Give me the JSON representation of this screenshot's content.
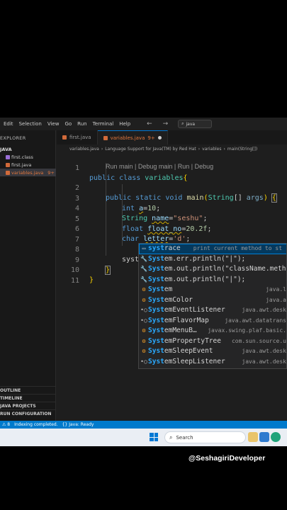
{
  "menubar": {
    "items": [
      "Edit",
      "Selection",
      "View",
      "Go",
      "Run",
      "Terminal",
      "Help"
    ],
    "nav_arrows": "← →",
    "search_text": "java"
  },
  "sidebar": {
    "title": "EXPLORER",
    "folder": "JAVA",
    "files": [
      {
        "name": "first.class",
        "badge": ""
      },
      {
        "name": "first.java",
        "badge": ""
      },
      {
        "name": "variables.java",
        "badge": "9+"
      }
    ],
    "sections": [
      "OUTLINE",
      "TIMELINE",
      "JAVA PROJECTS",
      "RUN CONFIGURATION"
    ]
  },
  "tabs": [
    {
      "label": "first.java",
      "badge": ""
    },
    {
      "label": "variables.java",
      "badge": "9+"
    }
  ],
  "breadcrumb": {
    "file": "variables.java",
    "lang": "Language Support for Java(TM) by Red Hat",
    "class": "variables",
    "method": "main(String[])"
  },
  "editor": {
    "line_numbers": [
      "1",
      "",
      "2",
      "3",
      "4",
      "5",
      "6",
      "7",
      "8",
      "9",
      "10",
      "11"
    ],
    "codelens": "Run main | Debug main | Run | Debug",
    "lines": {
      "l1": {
        "k1": "public",
        "k2": "class",
        "name": "variables",
        "brace": "{"
      },
      "l2": {
        "k1": "public",
        "k2": "static",
        "k3": "void",
        "fn": "main",
        "p1": "(",
        "ty": "String",
        "p2": "[] ",
        "arg": "args",
        "p3": ")",
        "brace": "{"
      },
      "l3": {
        "ty": "int",
        "var": "a",
        "eq": "=",
        "num": "10",
        "end": ";"
      },
      "l4": {
        "ty": "String",
        "var": "name",
        "eq": "=",
        "str": "\"seshu\"",
        "end": ";"
      },
      "l5": {
        "ty": "float",
        "var": "float_no",
        "eq": "=",
        "num": "20.2f",
        "end": ";"
      },
      "l6": {
        "ty": "char",
        "var": "letter",
        "eq": "=",
        "str": "'d'",
        "end": ";"
      },
      "l8": {
        "text": "syst"
      },
      "l9": {
        "brace": "}"
      },
      "l10": {
        "brace": "}"
      }
    }
  },
  "suggestions": [
    {
      "icon": "snippet-icon",
      "glyph": "▭",
      "match": "syst",
      "rest": "race",
      "detail": "print current method to st"
    },
    {
      "icon": "wrench-icon",
      "glyph": "🔧",
      "match": "Syst",
      "rest": "em.err.println(\"|\");",
      "detail": ""
    },
    {
      "icon": "wrench-icon",
      "glyph": "🔧",
      "match": "Syst",
      "rest": "em.out.println(\"className.meth",
      "detail": ""
    },
    {
      "icon": "wrench-icon",
      "glyph": "🔧",
      "match": "Syst",
      "rest": "em.out.println(\"|\");",
      "detail": ""
    },
    {
      "icon": "class-icon",
      "glyph": "⚙",
      "match": "Syst",
      "rest": "em",
      "detail": "java.l"
    },
    {
      "icon": "class-icon",
      "glyph": "⚙",
      "match": "Syst",
      "rest": "emColor",
      "detail": "java.a"
    },
    {
      "icon": "interface-icon",
      "glyph": "•○",
      "match": "Syst",
      "rest": "emEventListener",
      "detail": "java.awt.desk"
    },
    {
      "icon": "interface-icon",
      "glyph": "•○",
      "match": "Syst",
      "rest": "emFlavorMap",
      "detail": "java.awt.datatrans"
    },
    {
      "icon": "class-icon",
      "glyph": "⚙",
      "match": "Syst",
      "rest": "emMenuB…",
      "detail": "javax.swing.plaf.basic."
    },
    {
      "icon": "class-icon",
      "glyph": "⚙",
      "match": "Syst",
      "rest": "emPropertyTree",
      "detail": "com.sun.source.u"
    },
    {
      "icon": "class-icon",
      "glyph": "⚙",
      "match": "Syst",
      "rest": "emSleepEvent",
      "detail": "java.awt.desk"
    },
    {
      "icon": "interface-icon",
      "glyph": "•○",
      "match": "Syst",
      "rest": "emSleepListener",
      "detail": "java.awt.desk"
    }
  ],
  "statusbar": {
    "problems": "⚠ 8",
    "indexing": "Indexing completed.",
    "java_status": "Java: Ready"
  },
  "taskbar": {
    "search_placeholder": "Search"
  },
  "watermark": "@SeshagiriDeveloper",
  "colors": {
    "editor_bg": "#1e1e1e",
    "statusbar": "#007acc",
    "accent_orange": "#e2773d",
    "keyword": "#569cd6",
    "type": "#4ec9b0",
    "string": "#ce9178"
  }
}
